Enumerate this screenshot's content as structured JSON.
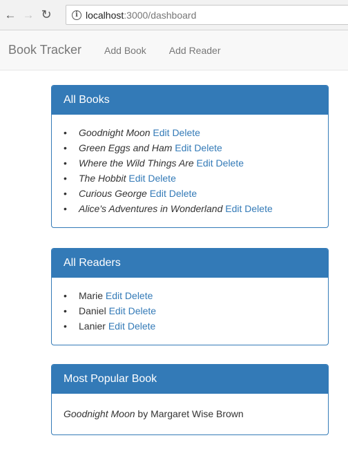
{
  "browser": {
    "back_icon": "back-arrow-icon",
    "forward_icon": "forward-arrow-icon",
    "reload_icon": "reload-icon",
    "url_host": "localhost",
    "url_path": ":3000/dashboard"
  },
  "navbar": {
    "brand": "Book Tracker",
    "links": [
      "Add Book",
      "Add Reader"
    ]
  },
  "all_books": {
    "title": "All Books",
    "items": [
      {
        "title": "Goodnight Moon",
        "edit": "Edit",
        "delete": "Delete"
      },
      {
        "title": "Green Eggs and Ham",
        "edit": "Edit",
        "delete": "Delete"
      },
      {
        "title": "Where the Wild Things Are",
        "edit": "Edit",
        "delete": "Delete"
      },
      {
        "title": "The Hobbit",
        "edit": "Edit",
        "delete": "Delete"
      },
      {
        "title": "Curious George",
        "edit": "Edit",
        "delete": "Delete"
      },
      {
        "title": "Alice's Adventures in Wonderland",
        "edit": "Edit",
        "delete": "Delete"
      }
    ]
  },
  "all_readers": {
    "title": "All Readers",
    "items": [
      {
        "name": "Marie",
        "edit": "Edit",
        "delete": "Delete"
      },
      {
        "name": "Daniel",
        "edit": "Edit",
        "delete": "Delete"
      },
      {
        "name": "Lanier",
        "edit": "Edit",
        "delete": "Delete"
      }
    ]
  },
  "most_popular": {
    "title": "Most Popular Book",
    "book_title": "Goodnight Moon",
    "by_text": "by Margaret Wise Brown"
  },
  "colors": {
    "primary": "#337ab7",
    "navbar_bg": "#f8f8f8",
    "link": "#337ab7"
  }
}
